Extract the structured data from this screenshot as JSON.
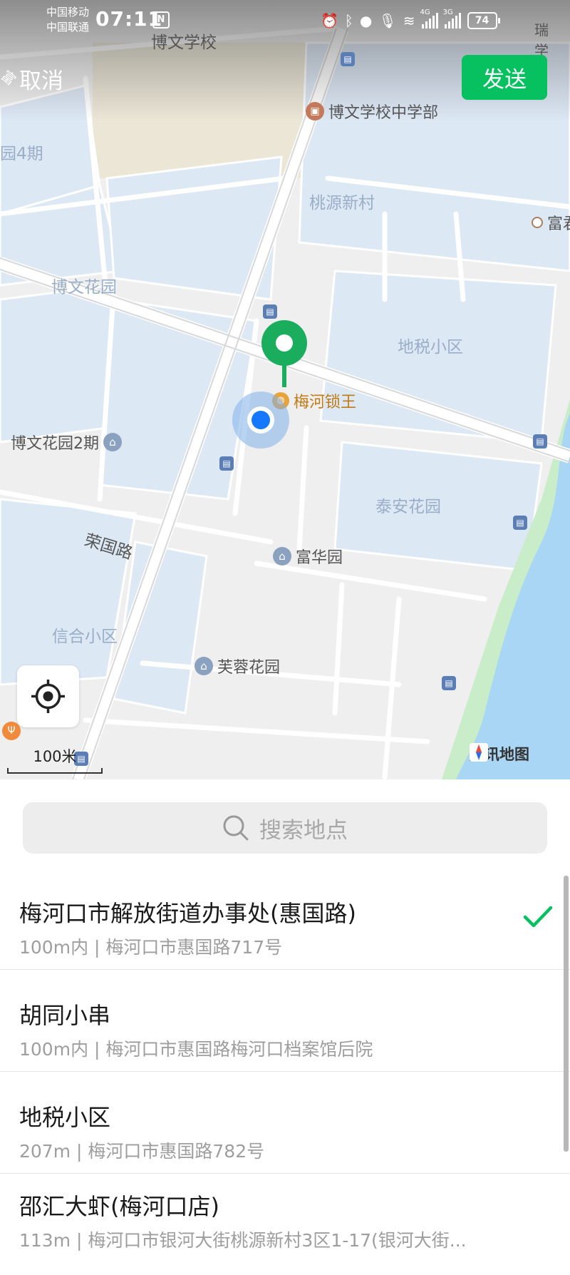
{
  "status_bar": {
    "carrier_1": "中国移动",
    "carrier_2": "中国联通",
    "time": "07:11",
    "nfc": "N",
    "net_1": "4G",
    "net_2": "3G",
    "battery": "74"
  },
  "header": {
    "cancel_label": "取消",
    "send_label": "发送"
  },
  "colors": {
    "accent": "#07c160",
    "water": "#a9d6f5",
    "green": "#c9ecc9",
    "residential": "#dde8f5"
  },
  "map": {
    "labels": {
      "bowen_school": "博文学校",
      "bowen_middle": "博文学校中学部",
      "taoyuan": "桃源新村",
      "bowen_garden": "博文花园",
      "bowen_garden2": "博文花园2期",
      "dishui": "地税小区",
      "meihe_lock": "梅河锁王",
      "taian": "泰安花园",
      "rongguo_road": "荣国路",
      "fuhua": "富华园",
      "xinhe": "信合小区",
      "furong": "芙蓉花园",
      "edge_4qi": "园4期",
      "edge_fu": "富",
      "edge_fu2": "富君",
      "edge_rui": "瑞",
      "edge_xue": "学"
    },
    "scale_label": "100米",
    "attribution": "腾讯地图",
    "icons": [
      "crosshair-icon",
      "home-icon",
      "bus-stop-icon",
      "map-pin-icon"
    ]
  },
  "search": {
    "placeholder": "搜索地点"
  },
  "places": [
    {
      "name": "梅河口市解放街道办事处(惠国路)",
      "address": "100m内 | 梅河口市惠国路717号",
      "selected": true
    },
    {
      "name": "胡同小串",
      "address": "100m内 | 梅河口市惠国路梅河口档案馆后院",
      "selected": false
    },
    {
      "name": "地税小区",
      "address": "207m | 梅河口市惠国路782号",
      "selected": false
    },
    {
      "name": "邵汇大虾(梅河口店)",
      "address": "113m | 梅河口市银河大街桃源新村3区1-17(银河大街...",
      "selected": false
    }
  ]
}
